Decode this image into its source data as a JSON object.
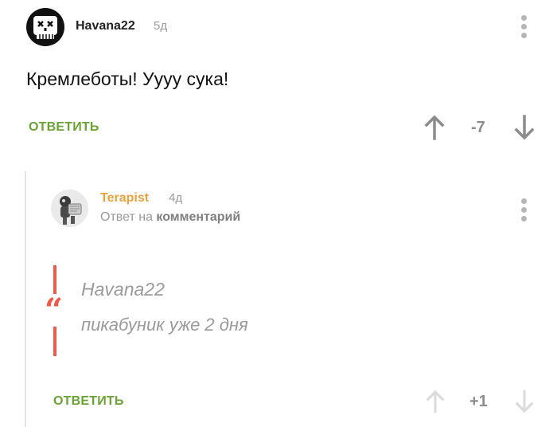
{
  "comment": {
    "username": "Havana22",
    "time": "5д",
    "text": "Кремлеботы! Уууу сука!",
    "reply_label": "ОТВЕТИТЬ",
    "score": "-7"
  },
  "reply_comment": {
    "username": "Terapist",
    "time": "4д",
    "reply_to_prefix": "Ответ на",
    "reply_to_link": "комментарий",
    "quote_author": "Havana22",
    "quote_text": "пикабуник уже 2 дня",
    "reply_label": "ОТВЕТИТЬ",
    "score": "+1"
  },
  "colors": {
    "accent_green": "#6aa334",
    "username_orange": "#e8a33d",
    "quote_red": "#ef5a4a",
    "muted_gray": "#9a9a9a"
  },
  "icons": {
    "main_avatar": "skull-avatar-icon",
    "reply_avatar": "robot-avatar-icon",
    "more": "vertical-dots-icon",
    "upvote": "arrow-up-icon",
    "downvote": "arrow-down-icon",
    "quote": "quote-mark-icon"
  }
}
